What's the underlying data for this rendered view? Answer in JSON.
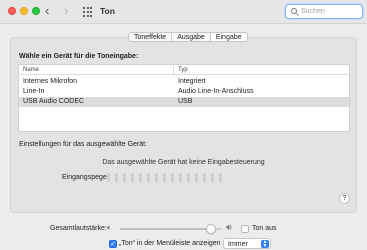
{
  "window": {
    "title": "Ton"
  },
  "search": {
    "placeholder": "Suchen"
  },
  "tabs": [
    {
      "label": "Toneffekte",
      "active": false
    },
    {
      "label": "Ausgabe",
      "active": false
    },
    {
      "label": "Eingabe",
      "active": true
    }
  ],
  "input": {
    "heading": "Wähle ein Gerät für die Toneingabe:",
    "columns": {
      "name": "Name",
      "type": "Typ"
    },
    "devices": [
      {
        "name": "Internes Mikrofon",
        "type": "Integriert"
      },
      {
        "name": "Line-In",
        "type": "Audio Line-In-Anschluss"
      },
      {
        "name": "USB Audio CODEC",
        "type": "USB"
      }
    ],
    "selected_index": 2,
    "settings_label": "Einstellungen für das ausgewählte Gerät:",
    "no_control_text": "Das ausgewählte Gerät hat keine Eingabesteuerung",
    "level_label": "Eingangspegel:",
    "level_segments": 15
  },
  "help": {
    "label": "?"
  },
  "output": {
    "volume_label": "Gesamtlautstärke:",
    "volume_level": 0.93,
    "mute_label": "Ton aus",
    "mute_checked": false,
    "menubar_label": "„Ton“ in der Menüleiste anzeigen",
    "menubar_checked": true,
    "menubar_mode": "Immer"
  },
  "colors": {
    "accent": "#2f7cf6",
    "selected_row": "#dcdcdc"
  }
}
